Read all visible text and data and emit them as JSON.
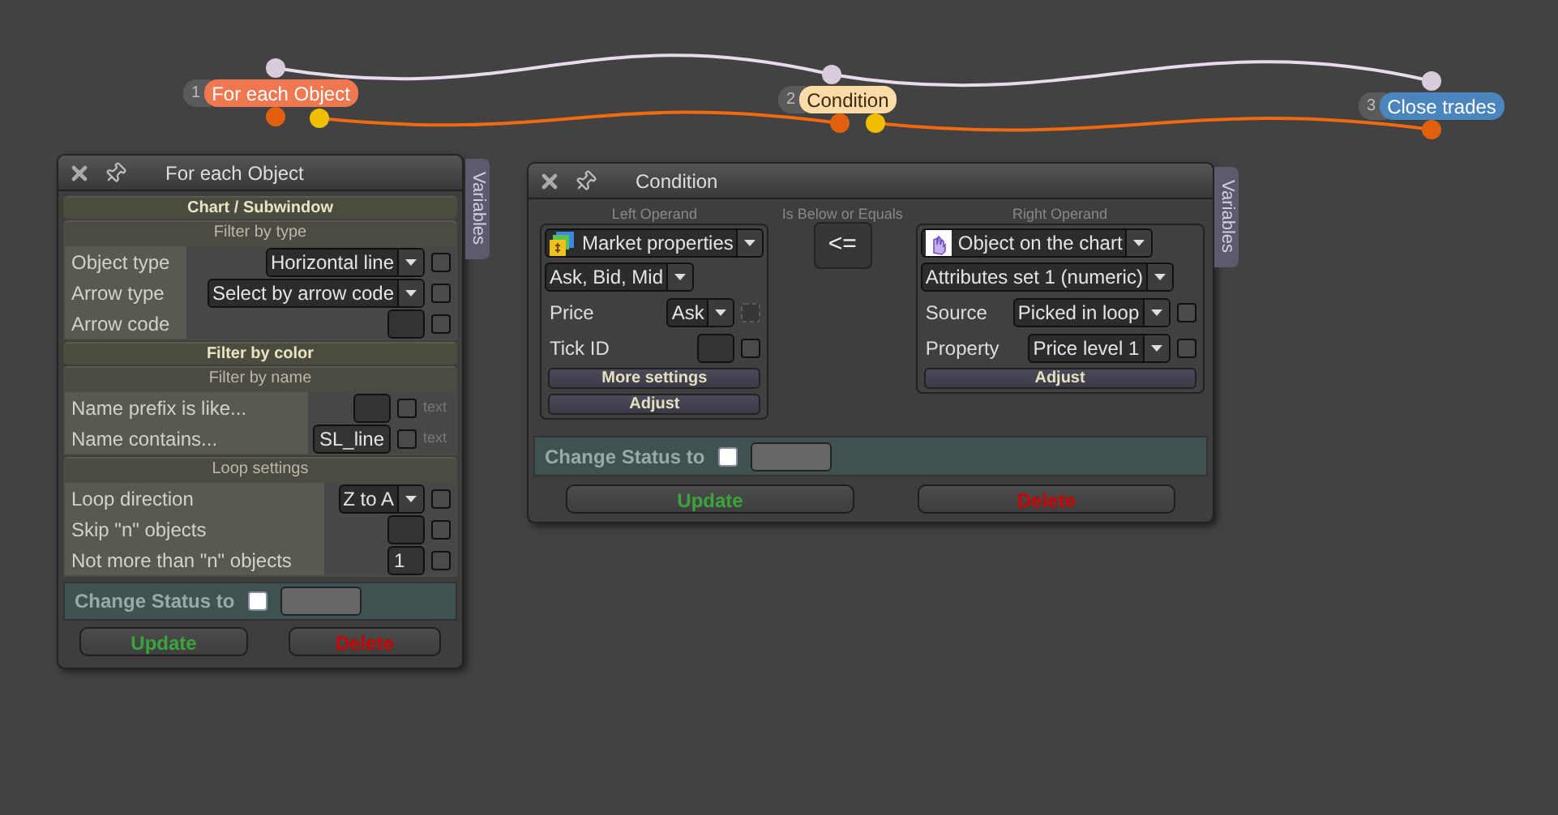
{
  "nodes": [
    {
      "number": "1",
      "label": "For each Object",
      "color": "#f07850"
    },
    {
      "number": "2",
      "label": "Condition",
      "color": "#fcdca6"
    },
    {
      "number": "3",
      "label": "Close trades",
      "color": "#4a86bd"
    }
  ],
  "loop_panel": {
    "title": "For each Object",
    "side_tab": "Variables",
    "groups": [
      {
        "kind": "section",
        "label": "Chart / Subwindow"
      },
      {
        "kind": "group",
        "label": "Filter by type",
        "rows": [
          {
            "kind": "select",
            "label": "Object type",
            "value": "Horizontal line",
            "checked": false
          },
          {
            "kind": "select",
            "label": "Arrow type",
            "value": "Select by arrow code",
            "checked": false
          },
          {
            "kind": "input",
            "label": "Arrow code",
            "checked": false
          }
        ]
      },
      {
        "kind": "section",
        "label": "Filter by color"
      },
      {
        "kind": "group",
        "label": "Filter by name",
        "rows": [
          {
            "kind": "input",
            "label": "Name prefix is like...",
            "suffix": "text",
            "checked": false
          },
          {
            "kind": "input",
            "label": "Name contains...",
            "value": "SL_line",
            "suffix": "text",
            "checked": false
          }
        ]
      },
      {
        "kind": "group",
        "label": "Loop settings",
        "rows": [
          {
            "kind": "select",
            "label": "Loop direction",
            "value": "Z to A",
            "checked": false
          },
          {
            "kind": "input",
            "label": "Skip \"n\" objects",
            "checked": false
          },
          {
            "kind": "input",
            "label": "Not more than \"n\" objects",
            "value": "1",
            "checked": false
          }
        ]
      }
    ],
    "change_status": {
      "label": "Change Status to",
      "checked": false
    },
    "buttons": [
      {
        "kind": "update",
        "label": "Update"
      },
      {
        "kind": "delete",
        "label": "Delete"
      }
    ]
  },
  "condition_panel": {
    "title": "Condition",
    "side_tab": "Variables",
    "left_operand": {
      "caption": "Left Operand",
      "source": "Market properties",
      "subsource": "Ask, Bid, Mid",
      "rows": [
        {
          "kind": "select",
          "label": "Price",
          "value": "Ask",
          "checked": false,
          "disabled": true
        },
        {
          "kind": "input",
          "label": "Tick ID",
          "checked": false,
          "disabled": false
        }
      ],
      "buttons": [
        "More settings",
        "Adjust"
      ]
    },
    "operator": {
      "caption": "Is Below or Equals",
      "symbol": "<="
    },
    "right_operand": {
      "caption": "Right Operand",
      "source": "Object on the chart",
      "subsource": "Attributes set 1 (numeric)",
      "rows": [
        {
          "kind": "select",
          "label": "Source",
          "value": "Picked in loop",
          "checked": false,
          "disabled": false
        },
        {
          "kind": "select",
          "label": "Property",
          "value": "Price level 1",
          "checked": false,
          "disabled": false
        }
      ],
      "buttons": [
        "Adjust"
      ]
    },
    "change_status": {
      "label": "Change Status to",
      "checked": false
    },
    "buttons": [
      {
        "kind": "update",
        "label": "Update"
      },
      {
        "kind": "delete",
        "label": "Delete"
      }
    ]
  }
}
